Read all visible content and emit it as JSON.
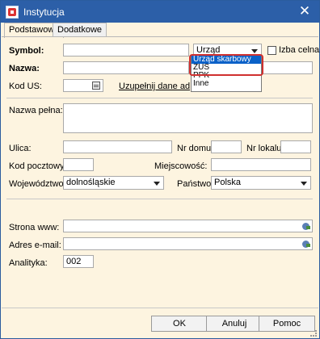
{
  "window": {
    "title": "Instytucja"
  },
  "tabs": [
    "Podstawowe",
    "Dodatkowe"
  ],
  "form": {
    "symbol_label": "Symbol:",
    "symbol_value": "",
    "type_combo": {
      "selected": "Urząd skarbowy",
      "options": [
        "Urząd skarbowy",
        "ZUS",
        "PPK",
        "Inne"
      ],
      "open": true,
      "highlighted_option": "ZUS"
    },
    "izba_label": "Izba celna",
    "nazwa_label": "Nazwa:",
    "nazwa_value": "",
    "kod_us_label": "Kod US:",
    "kod_us_value": "",
    "uzupelnij_link": "Uzupełnij dane adresowe",
    "nazwa_pelna_label": "Nazwa pełna:",
    "ulica_label": "Ulica:",
    "nr_domu_label": "Nr domu:",
    "nr_lokalu_label": "Nr lokalu:",
    "kod_pocztowy_label": "Kod pocztowy:",
    "miejscowosc_label": "Miejscowość:",
    "wojewodztwo_label": "Województwo:",
    "wojewodztwo_value": "dolnośląskie",
    "panstwo_label": "Państwo:",
    "panstwo_value": "Polska",
    "strona_label": "Strona www:",
    "email_label": "Adres e-mail:",
    "analityka_label": "Analityka:",
    "analityka_value": "002"
  },
  "buttons": {
    "ok": "OK",
    "anuluj": "Anuluj",
    "pomoc": "Pomoc"
  }
}
